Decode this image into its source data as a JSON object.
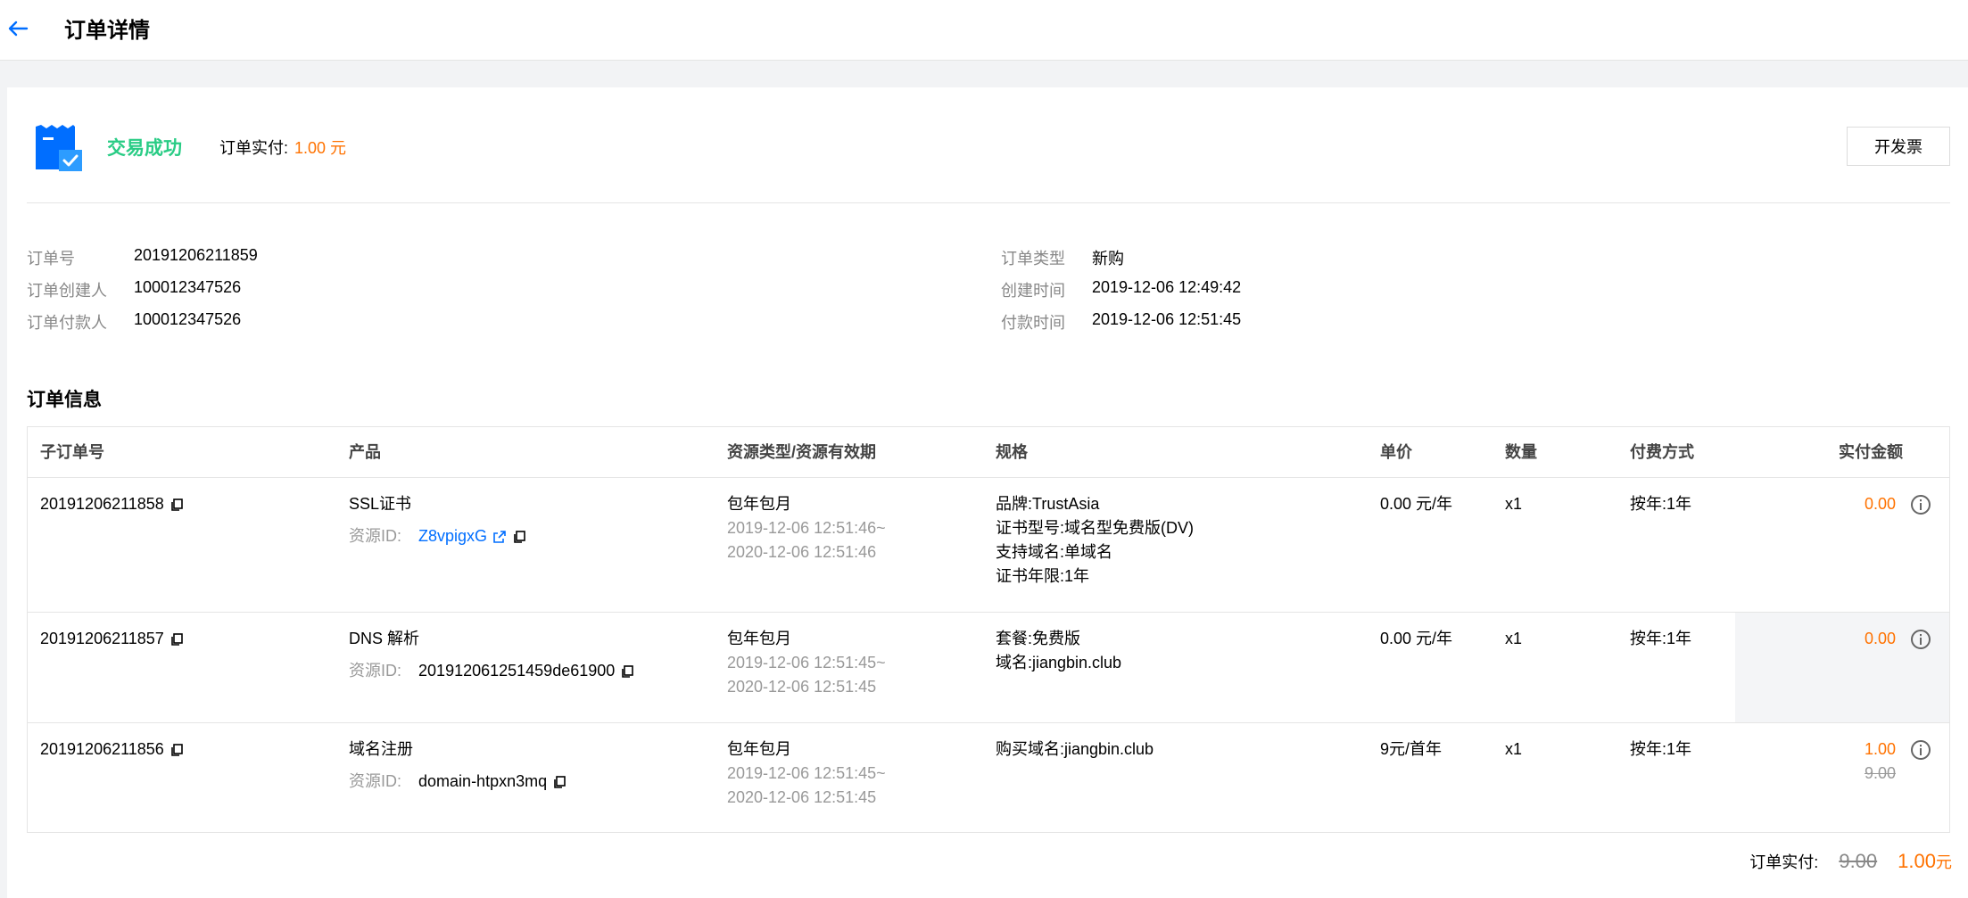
{
  "header": {
    "title": "订单详情"
  },
  "status": {
    "text": "交易成功",
    "paid_label": "订单实付:",
    "paid_value": "1.00 元",
    "invoice_button": "开发票"
  },
  "meta": {
    "left": [
      {
        "label": "订单号",
        "value": "20191206211859"
      },
      {
        "label": "订单创建人",
        "value": "100012347526"
      },
      {
        "label": "订单付款人",
        "value": "100012347526"
      }
    ],
    "right": [
      {
        "label": "订单类型",
        "value": "新购"
      },
      {
        "label": "创建时间",
        "value": "2019-12-06 12:49:42"
      },
      {
        "label": "付款时间",
        "value": "2019-12-06 12:51:45"
      }
    ]
  },
  "section_title": "订单信息",
  "table": {
    "headers": [
      "子订单号",
      "产品",
      "资源类型/资源有效期",
      "规格",
      "单价",
      "数量",
      "付费方式",
      "实付金额"
    ],
    "rows": [
      {
        "sub_order": "20191206211858",
        "product": "SSL证书",
        "resource_label": "资源ID:",
        "resource_id": "Z8vpigxG",
        "resource_type": "包年包月",
        "period_start": "2019-12-06 12:51:46~",
        "period_end": "2020-12-06 12:51:46",
        "spec": [
          "品牌:TrustAsia",
          "证书型号:域名型免费版(DV)",
          "支持域名:单域名",
          "证书年限:1年"
        ],
        "unit_price": "0.00 元/年",
        "quantity": "x1",
        "billing": "按年:1年",
        "paid": "0.00",
        "original": ""
      },
      {
        "sub_order": "20191206211857",
        "product": "DNS 解析",
        "resource_label": "资源ID:",
        "resource_id": "201912061251459de61900",
        "resource_type": "包年包月",
        "period_start": "2019-12-06 12:51:45~",
        "period_end": "2020-12-06 12:51:45",
        "spec": [
          "套餐:免费版",
          "域名:jiangbin.club"
        ],
        "unit_price": "0.00 元/年",
        "quantity": "x1",
        "billing": "按年:1年",
        "paid": "0.00",
        "original": ""
      },
      {
        "sub_order": "20191206211856",
        "product": "域名注册",
        "resource_label": "资源ID:",
        "resource_id": "domain-htpxn3mq",
        "resource_type": "包年包月",
        "period_start": "2019-12-06 12:51:45~",
        "period_end": "2020-12-06 12:51:45",
        "spec": [
          "购买域名:jiangbin.club"
        ],
        "unit_price": "9元/首年",
        "quantity": "x1",
        "billing": "按年:1年",
        "paid": "1.00",
        "original": "9.00"
      }
    ]
  },
  "total": {
    "label": "订单实付:",
    "original": "9.00",
    "paid": "1.00",
    "unit": "元"
  },
  "colors": {
    "accent": "#006eff",
    "success": "#29cc85",
    "price": "#ff7200"
  }
}
